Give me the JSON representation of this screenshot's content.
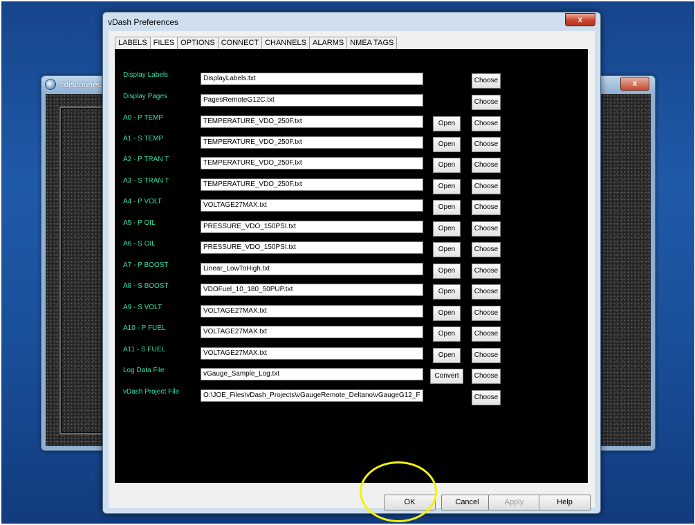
{
  "background_window": {
    "title": "::disconnecte",
    "close_symbol": "x"
  },
  "side_icons": [
    "chart-icon",
    "circle-icon",
    "check-icon",
    "document-icon"
  ],
  "dialog": {
    "title": "vDash Preferences",
    "close_symbol": "x"
  },
  "tabs": [
    "LABELS",
    "FILES",
    "OPTIONS",
    "CONNECT",
    "CHANNELS",
    "ALARMS",
    "NMEA TAGS"
  ],
  "active_tab": "FILES",
  "rows": [
    {
      "label": "Display Labels",
      "value": "DisplayLabels.txt",
      "action": "",
      "choose": "Choose"
    },
    {
      "label": "Display Pages",
      "value": "PagesRemoteG12C.txt",
      "action": "",
      "choose": "Choose"
    },
    {
      "label": "A0 - P TEMP",
      "value": "TEMPERATURE_VDO_250F.txt",
      "action": "Open",
      "choose": "Choose"
    },
    {
      "label": "A1 - S TEMP",
      "value": "TEMPERATURE_VDO_250F.txt",
      "action": "Open",
      "choose": "Choose"
    },
    {
      "label": "A2 - P TRAN T",
      "value": "TEMPERATURE_VDO_250F.txt",
      "action": "Open",
      "choose": "Choose"
    },
    {
      "label": "A3 - S TRAN T",
      "value": "TEMPERATURE_VDO_250F.txt",
      "action": "Open",
      "choose": "Choose"
    },
    {
      "label": "A4 - P VOLT",
      "value": "VOLTAGE27MAX.txt",
      "action": "Open",
      "choose": "Choose"
    },
    {
      "label": "A5 - P OIL",
      "value": "PRESSURE_VDO_150PSI.txt",
      "action": "Open",
      "choose": "Choose"
    },
    {
      "label": "A6 - S OIL",
      "value": "PRESSURE_VDO_150PSI.txt",
      "action": "Open",
      "choose": "Choose"
    },
    {
      "label": "A7 - P BOOST",
      "value": "Linear_LowToHigh.txt",
      "action": "Open",
      "choose": "Choose"
    },
    {
      "label": "A8 - S BOOST",
      "value": "VDOFuel_10_180_50PUP.txt",
      "action": "Open",
      "choose": "Choose"
    },
    {
      "label": "A9 - S VOLT",
      "value": "VOLTAGE27MAX.txt",
      "action": "Open",
      "choose": "Choose"
    },
    {
      "label": "A10 - P FUEL",
      "value": "VOLTAGE27MAX.txt",
      "action": "Open",
      "choose": "Choose"
    },
    {
      "label": "A11 - S FUEL",
      "value": "VOLTAGE27MAX.txt",
      "action": "Open",
      "choose": "Choose"
    },
    {
      "label": "Log Data File",
      "value": "vGauge_Sample_Log.txt",
      "action": "Convert",
      "choose": "Choose"
    },
    {
      "label": "vDash Project File",
      "value": "O:\\JOE_Files\\vDash_Projects\\vGaugeRemote_Deltano\\vGaugeG12_F",
      "action": "",
      "choose": "Choose"
    }
  ],
  "buttons": {
    "ok": "OK",
    "cancel": "Cancel",
    "apply": "Apply",
    "help": "Help"
  }
}
